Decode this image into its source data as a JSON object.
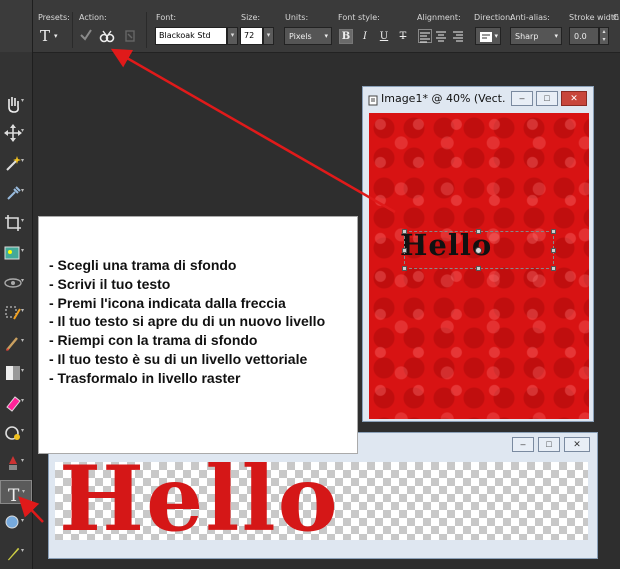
{
  "toolbar": {
    "presets_label": "Presets:",
    "preset_glyph": "T",
    "action_label": "Action:",
    "font_label": "Font:",
    "font_value": "Blackoak Std",
    "size_label": "Size:",
    "size_value": "72",
    "units_label": "Units:",
    "units_value": "Pixels",
    "font_style_label": "Font style:",
    "style_buttons": [
      "B",
      "I",
      "U",
      "T"
    ],
    "alignment_label": "Alignment:",
    "direction_label": "Direction:",
    "antialias_label": "Anti-alias:",
    "antialias_value": "Sharp",
    "stroke_width_label": "Stroke width:",
    "stroke_width_value": "0.0",
    "overflow_label": "C"
  },
  "tools": [
    "pan-tool",
    "move-tool",
    "magic-wand-tool",
    "dropper-tool",
    "crop-tool",
    "picture-tube-tool",
    "eye-tool",
    "selection-brush-tool",
    "paint-brush-tool",
    "gradient-tool",
    "eraser-tool",
    "fill-tool",
    "color-replace-tool",
    "text-tool",
    "shape-tool",
    "pen-tool"
  ],
  "image_window": {
    "title": "Image1* @ 40% (Vect...",
    "text": "Hello"
  },
  "instructions": [
    "- Scegli una trama di sfondo",
    "- Scrivi il tuo testo",
    "- Premi l'icona indicata dalla freccia",
    "- Il tuo testo si apre du di un nuovo livello",
    "- Riempi con la trama di sfondo",
    "- Il tuo testo è su di un livello vettoriale",
    "- Trasformalo in livello raster"
  ],
  "result_window": {
    "text": "Hello"
  },
  "colors": {
    "arrow": "#e01a1a",
    "canvas_red": "#d81313",
    "hello_fill": "#d51717"
  }
}
